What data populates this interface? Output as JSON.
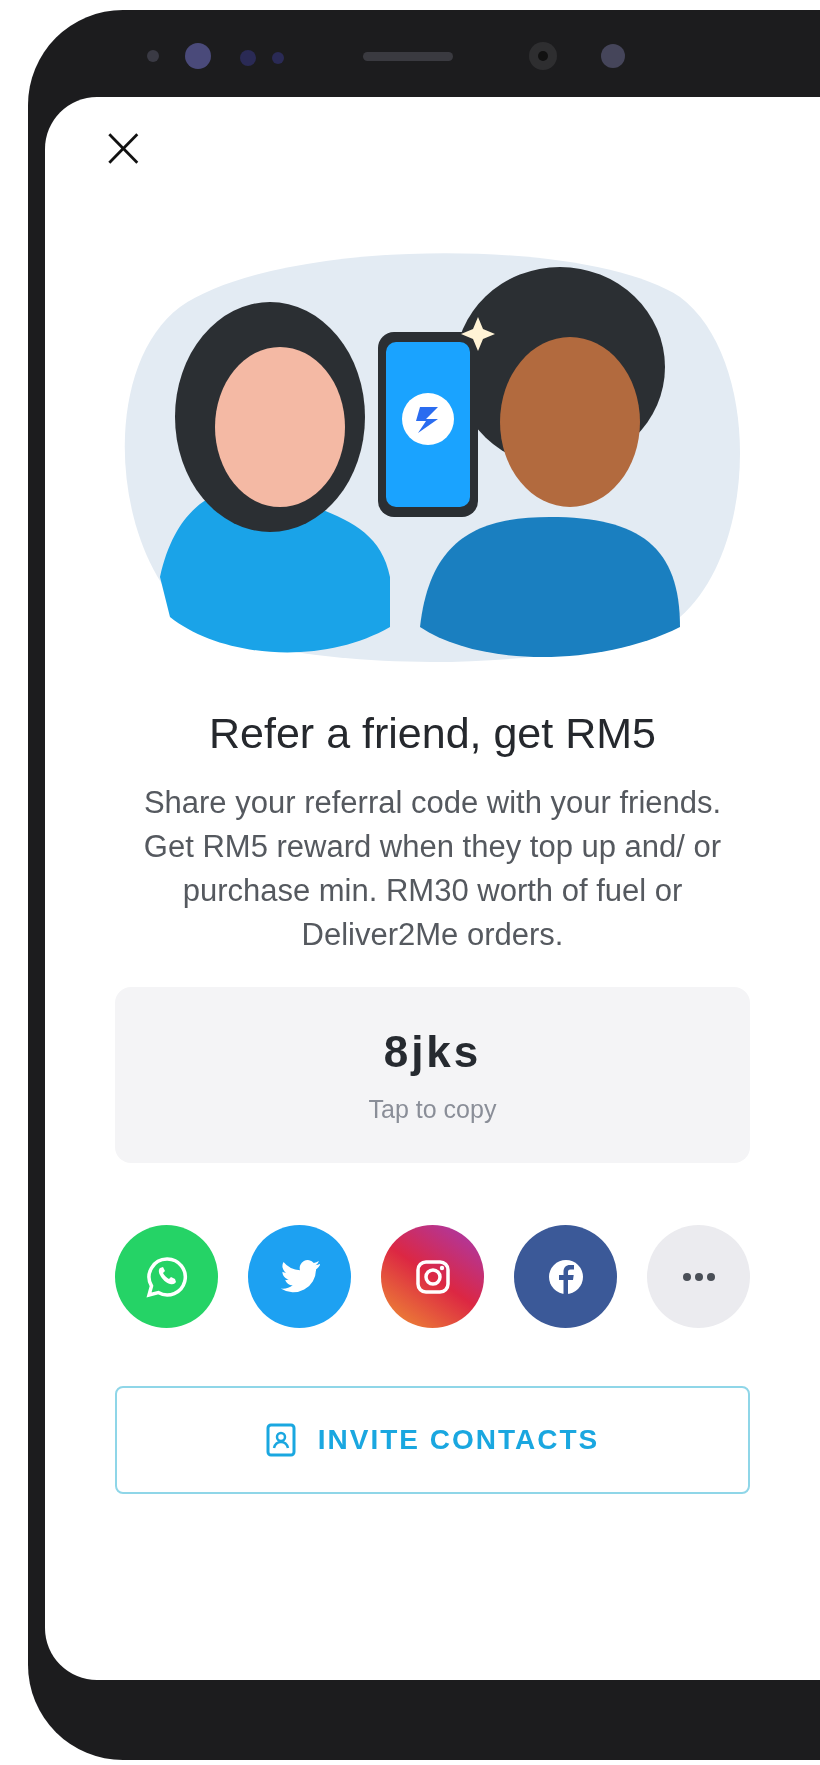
{
  "close_button": {
    "label": "×"
  },
  "title": "Refer a friend, get RM5",
  "description": "Share your referral code with your friends. Get RM5 reward when they top up and/ or purchase min. RM30 worth of fuel or Deliver2Me orders.",
  "referral_code": {
    "code": "8jks",
    "hint": "Tap to copy"
  },
  "share_buttons": [
    {
      "kind": "whatsapp",
      "color": "#25d366"
    },
    {
      "kind": "twitter",
      "color": "#1da1f2"
    },
    {
      "kind": "instagram",
      "color": "#c13584"
    },
    {
      "kind": "facebook",
      "color": "#3b5998"
    },
    {
      "kind": "more",
      "color": "#ebebef"
    }
  ],
  "invite_button": {
    "label": "INVITE CONTACTS"
  }
}
